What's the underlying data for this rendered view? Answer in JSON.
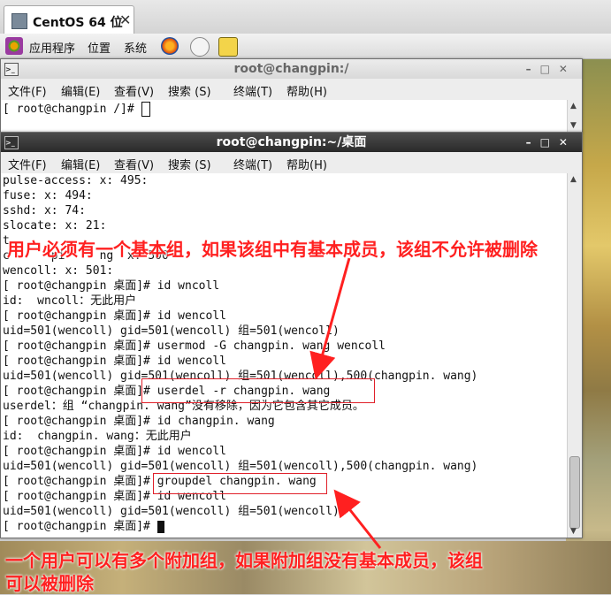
{
  "vm_tab": {
    "title": "CentOS 64 位",
    "close": "✕"
  },
  "panel": {
    "applications": "应用程序",
    "places": "位置",
    "system": "系统"
  },
  "menu": [
    "文件(F)",
    "编辑(E)",
    "查看(V)",
    "搜索 (S)",
    "终端(T)",
    "帮助(H)"
  ],
  "back_terminal": {
    "title": "root@changpin:/",
    "prompt": "[ root@changpin /]# "
  },
  "front_terminal": {
    "title": "root@changpin:~/桌面",
    "lines": [
      "pulse-access: x: 495:",
      "fuse: x: 494:",
      "sshd: x: 74:",
      "slocate: x: 21:",
      "t",
      "c      pi     ng  x: 500",
      "wencoll: x: 501:",
      "[ root@changpin 桌面]# id wncoll",
      "id:  wncoll：无此用户",
      "[ root@changpin 桌面]# id wencoll",
      "uid=501(wencoll) gid=501(wencoll) 组=501(wencoll)",
      "[ root@changpin 桌面]# usermod -G changpin. wang wencoll",
      "[ root@changpin 桌面]# id wencoll",
      "uid=501(wencoll) gid=501(wencoll) 组=501(wencoll),500(changpin. wang)",
      "[ root@changpin 桌面]# userdel -r changpin. wang",
      "userdel：组 “changpin. wang”没有移除，因为它包含其它成员。",
      "[ root@changpin 桌面]# id changpin. wang",
      "id:  changpin. wang：无此用户",
      "[ root@changpin 桌面]# id wencoll",
      "uid=501(wencoll) gid=501(wencoll) 组=501(wencoll),500(changpin. wang)",
      "[ root@changpin 桌面]# groupdel changpin. wang",
      "[ root@changpin 桌面]# id wencoll",
      "uid=501(wencoll) gid=501(wencoll) 组=501(wencoll)",
      "[ root@changpin 桌面]# "
    ]
  },
  "annotations": {
    "top": "用户必须有一个基本组，如果该组中有基本成员，该组不允许被删除",
    "bottom_line1": "一个用户可以有多个附加组，如果附加组没有基本成员，该组",
    "bottom_line2": "可以被删除",
    "color": "#ff2020"
  }
}
